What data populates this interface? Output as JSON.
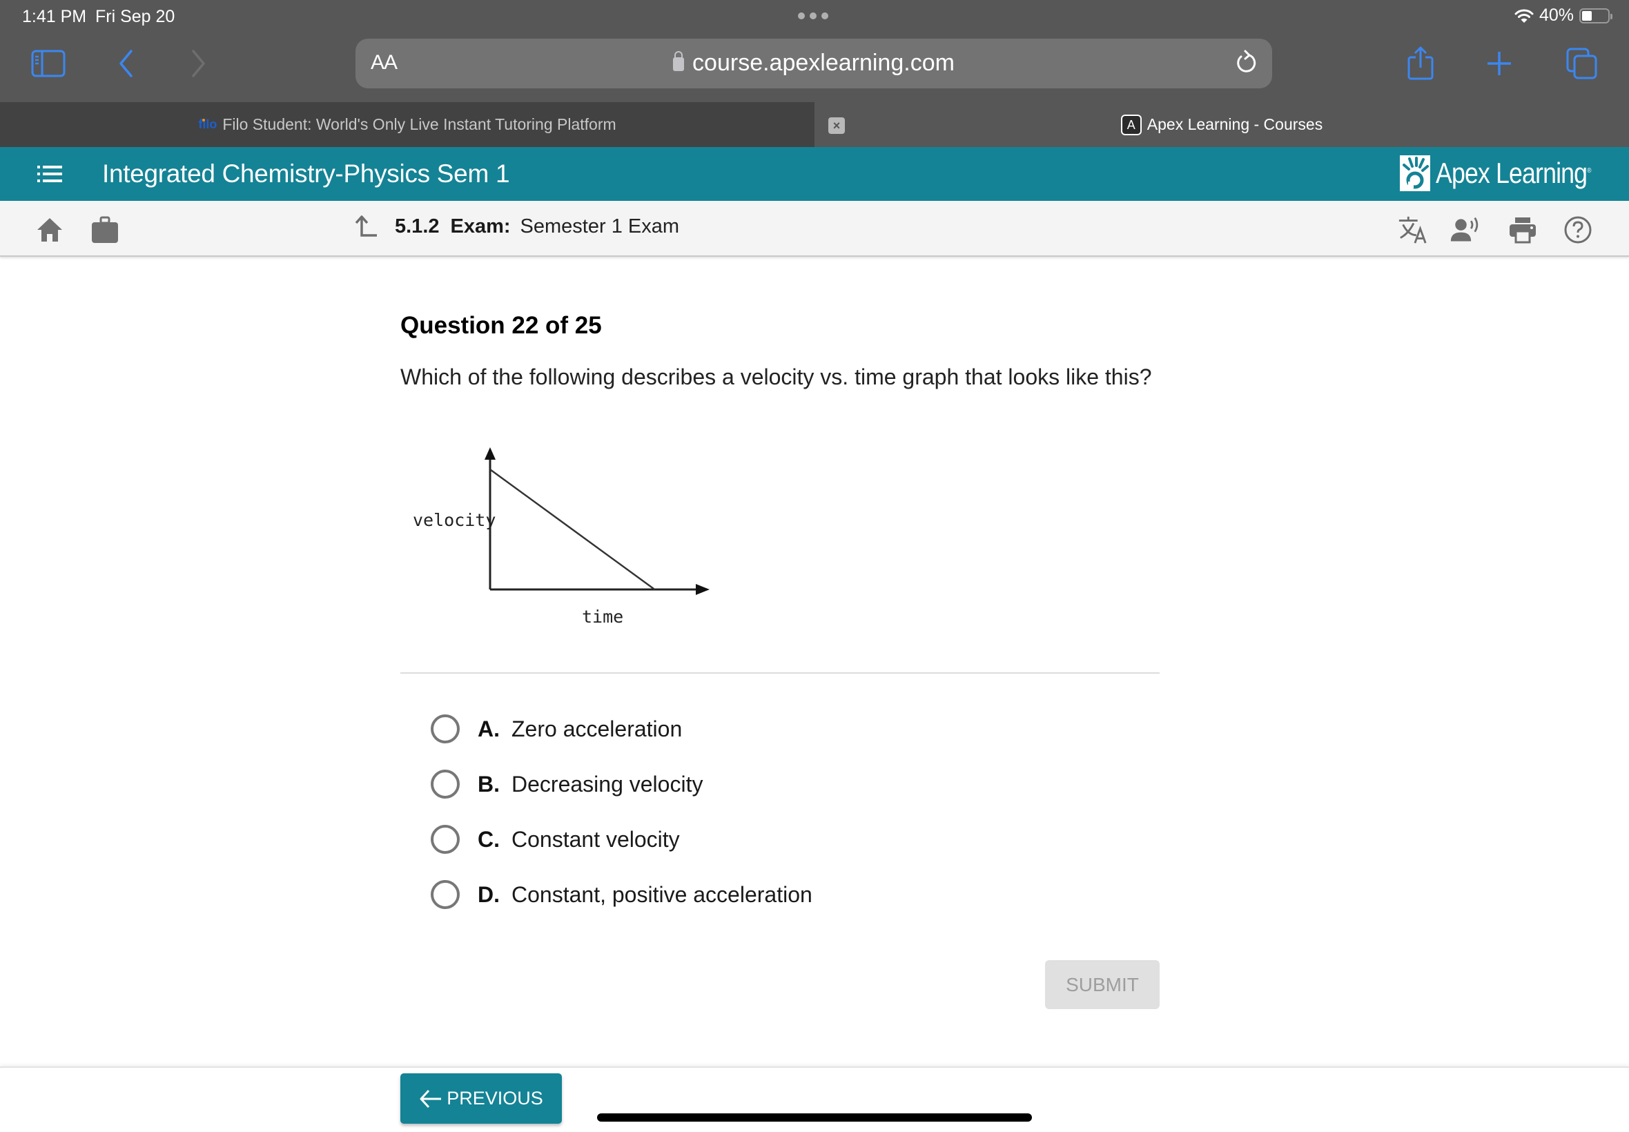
{
  "status_bar": {
    "time": "1:41 PM",
    "date": "Fri Sep 20",
    "battery_text": "40%",
    "battery_level": 0.4
  },
  "browser": {
    "text_size_label": "AA",
    "url": "course.apexlearning.com",
    "icons": {
      "sidebar": "sidebar-icon",
      "back": "chevron-left-icon",
      "forward": "chevron-right-icon",
      "lock": "lock-icon",
      "reload": "reload-icon",
      "share": "share-icon",
      "new_tab": "plus-icon",
      "tabs": "tabs-icon"
    },
    "accent_color": "#3b87f0",
    "tabs": [
      {
        "label": "Filo Student: World's Only Live Instant Tutoring Platform",
        "favicon": "filo",
        "active": true
      },
      {
        "label": "Apex Learning - Courses",
        "favicon": "A",
        "active": false
      }
    ]
  },
  "app": {
    "course_title": "Integrated Chemistry-Physics Sem 1",
    "brand_name": "Apex Learning",
    "brand_mark": "®",
    "header_color": "#148395",
    "breadcrumb": {
      "number": "5.1.2",
      "type": "Exam:",
      "name": "Semester 1 Exam"
    },
    "tool_icons": [
      "translate-icon",
      "read-aloud-icon",
      "print-icon",
      "help-icon"
    ]
  },
  "question": {
    "title": "Question 22 of 25",
    "prompt": "Which of the following describes a velocity vs. time graph that looks like this?",
    "graph": {
      "xlabel": "time",
      "ylabel": "velocity"
    },
    "options": [
      {
        "letter": "A.",
        "text": "Zero acceleration",
        "selected": false
      },
      {
        "letter": "B.",
        "text": "Decreasing velocity",
        "selected": false
      },
      {
        "letter": "C.",
        "text": "Constant velocity",
        "selected": false
      },
      {
        "letter": "D.",
        "text": "Constant, positive acceleration",
        "selected": false
      }
    ],
    "submit_label": "SUBMIT",
    "submit_enabled": false
  },
  "footer": {
    "previous_label": "PREVIOUS"
  },
  "chart_data": {
    "type": "line",
    "title": "",
    "xlabel": "time",
    "ylabel": "velocity",
    "series": [
      {
        "name": "velocity",
        "x": [
          0,
          1
        ],
        "y": [
          1,
          0
        ]
      }
    ],
    "x_ticks": [],
    "y_ticks": [],
    "xlim": [
      0,
      1.3
    ],
    "ylim": [
      0,
      1.15
    ],
    "grid": false,
    "legend": "none"
  }
}
